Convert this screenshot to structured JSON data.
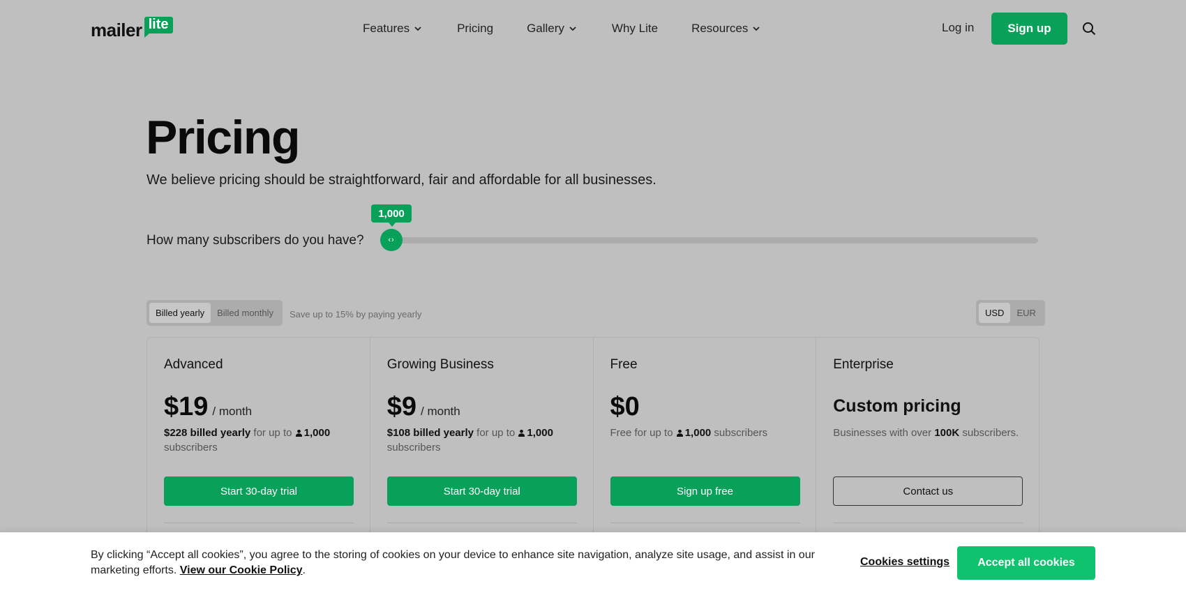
{
  "brand": {
    "logo_word": "mailer",
    "logo_badge": "lite"
  },
  "nav": {
    "items": [
      {
        "label": "Features",
        "has_dropdown": true
      },
      {
        "label": "Pricing",
        "has_dropdown": false
      },
      {
        "label": "Gallery",
        "has_dropdown": true
      },
      {
        "label": "Why Lite",
        "has_dropdown": false
      },
      {
        "label": "Resources",
        "has_dropdown": true
      }
    ],
    "login": "Log in",
    "signup": "Sign up",
    "search_icon": "search-icon"
  },
  "hero": {
    "title": "Pricing",
    "subtitle": "We believe pricing should be straightforward, fair and affordable for all businesses."
  },
  "slider": {
    "label": "How many subscribers do you have?",
    "value_label": "1,000",
    "level": 0.0,
    "thumb_glyph": "‹›"
  },
  "billing": {
    "options": [
      "Billed yearly",
      "Billed monthly"
    ],
    "selected": "Billed yearly",
    "note": "Save up to 15% by paying yearly"
  },
  "currency": {
    "options": [
      "USD",
      "EUR"
    ],
    "selected": "USD"
  },
  "plans": [
    {
      "name": "Advanced",
      "price": "$19",
      "per": "/ month",
      "desc_bold": "$228 billed yearly",
      "desc_mid": " for up to ",
      "desc_count": "1,000",
      "desc_tail": " subscribers",
      "cta": "Start 30-day trial"
    },
    {
      "name": "Growing Business",
      "price": "$9",
      "per": "/ month",
      "desc_bold": "$108 billed yearly",
      "desc_mid": " for up to ",
      "desc_count": "1,000",
      "desc_tail": " subscribers",
      "cta": "Start 30-day trial"
    },
    {
      "name": "Free",
      "price": "$0",
      "desc_pre": "Free for up to ",
      "desc_count": "1,000",
      "desc_tail": " subscribers",
      "cta": "Sign up free"
    },
    {
      "name": "Enterprise",
      "price": "Custom pricing",
      "desc_pre": "Businesses with over ",
      "desc_bold": "100K",
      "desc_tail": " subscribers.",
      "cta": "Contact us"
    }
  ],
  "cookie": {
    "text": "By clicking “Accept all cookies”, you agree to the storing of cookies on your device to enhance site navigation, analyze site usage, and assist in our marketing efforts. ",
    "link": "View our Cookie Policy",
    "end": ".",
    "settings": "Cookies settings",
    "accept": "Accept all cookies"
  },
  "colors": {
    "brand_green": "#09a05a",
    "accept_green": "#0fc26d",
    "overlay_gray": "#bfbfbf"
  }
}
